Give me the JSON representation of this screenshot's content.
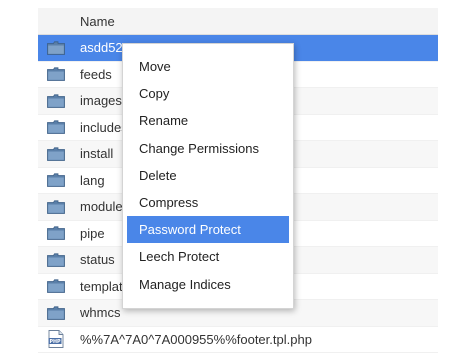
{
  "table": {
    "header": {
      "name_label": "Name"
    },
    "rows": [
      {
        "name": "asdd52",
        "type": "folder",
        "selected": true
      },
      {
        "name": "feeds",
        "type": "folder"
      },
      {
        "name": "images",
        "type": "folder"
      },
      {
        "name": "includes",
        "type": "folder"
      },
      {
        "name": "install",
        "type": "folder"
      },
      {
        "name": "lang",
        "type": "folder"
      },
      {
        "name": "modules",
        "type": "folder"
      },
      {
        "name": "pipe",
        "type": "folder"
      },
      {
        "name": "status",
        "type": "folder"
      },
      {
        "name": "templates",
        "type": "folder"
      },
      {
        "name": "whmcs",
        "type": "folder"
      },
      {
        "name": "%%7A^7A0^7A000955%%footer.tpl.php",
        "type": "php-file"
      }
    ]
  },
  "context_menu": {
    "items": [
      {
        "label": "Move"
      },
      {
        "label": "Copy"
      },
      {
        "label": "Rename"
      },
      {
        "label": "Change Permissions"
      },
      {
        "label": "Delete"
      },
      {
        "label": "Compress"
      },
      {
        "label": "Password Protect",
        "highlighted": true
      },
      {
        "label": "Leech Protect"
      },
      {
        "label": "Manage Indices"
      }
    ]
  },
  "colors": {
    "selection": "#4a86e8",
    "folder_icon": "#5a7fa8",
    "php_icon": "#4b6fa6"
  }
}
